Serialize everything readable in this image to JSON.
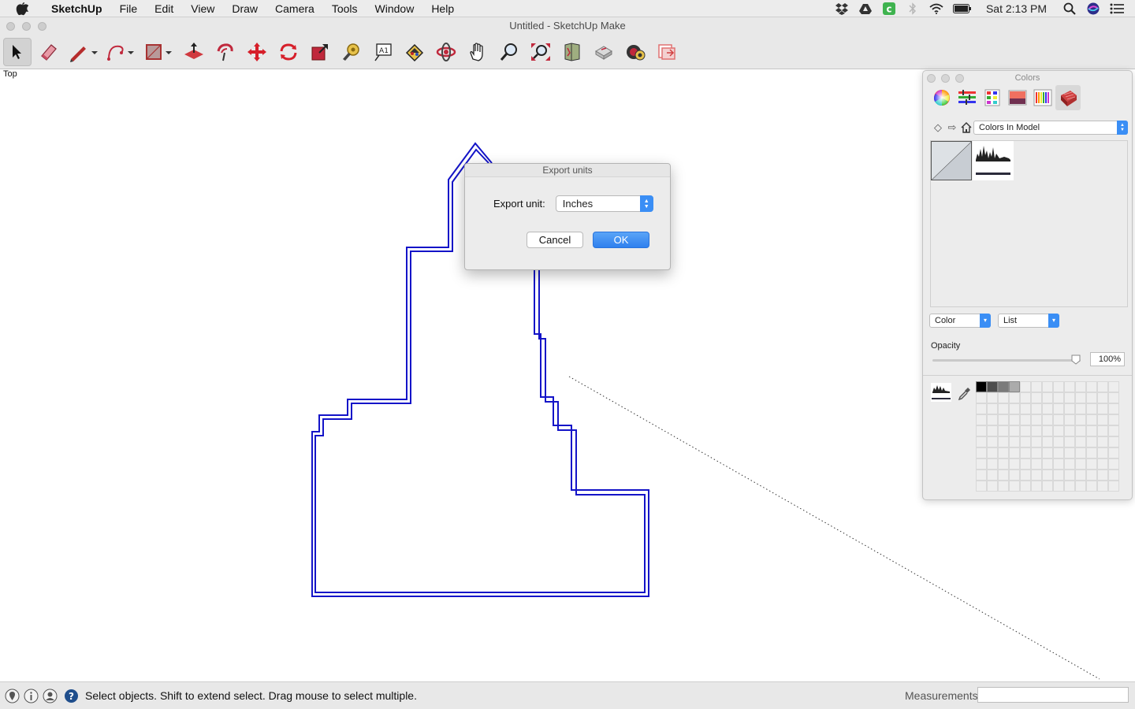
{
  "menubar": {
    "app": "SketchUp",
    "items": [
      "File",
      "Edit",
      "View",
      "Draw",
      "Camera",
      "Tools",
      "Window",
      "Help"
    ],
    "clock": "Sat 2:13 PM",
    "status_icons": [
      "dropbox-icon",
      "google-drive-icon",
      "green-c-icon",
      "bluetooth-icon",
      "wifi-icon",
      "battery-icon"
    ]
  },
  "window": {
    "title": "Untitled - SketchUp Make"
  },
  "toolbar": {
    "tools": [
      "select",
      "eraser",
      "line",
      "arc",
      "rectangle",
      "push-pull",
      "offset",
      "move",
      "rotate",
      "scale",
      "tape-measure",
      "text",
      "paint-bucket",
      "orbit",
      "pan",
      "zoom",
      "zoom-extents",
      "previous-view",
      "3d-warehouse",
      "extension-warehouse",
      "send-to-layout"
    ],
    "selected": "select"
  },
  "viewport": {
    "view_label": "Top"
  },
  "dialog": {
    "title": "Export units",
    "unit_label": "Export unit:",
    "unit_value": "Inches",
    "cancel": "Cancel",
    "ok": "OK"
  },
  "colors_panel": {
    "title": "Colors",
    "model_select": "Colors In Model",
    "type_select": "Color",
    "view_select": "List",
    "opacity_label": "Opacity",
    "opacity_value": "100%",
    "opacity_fraction": 1.0,
    "palette_filled": [
      "#000000",
      "#4d4d4d",
      "#7a7a7a",
      "#ababab"
    ]
  },
  "statusbar": {
    "hint": "Select objects. Shift to extend select. Drag mouse to select multiple.",
    "measurements_label": "Measurements",
    "measurements_value": ""
  }
}
